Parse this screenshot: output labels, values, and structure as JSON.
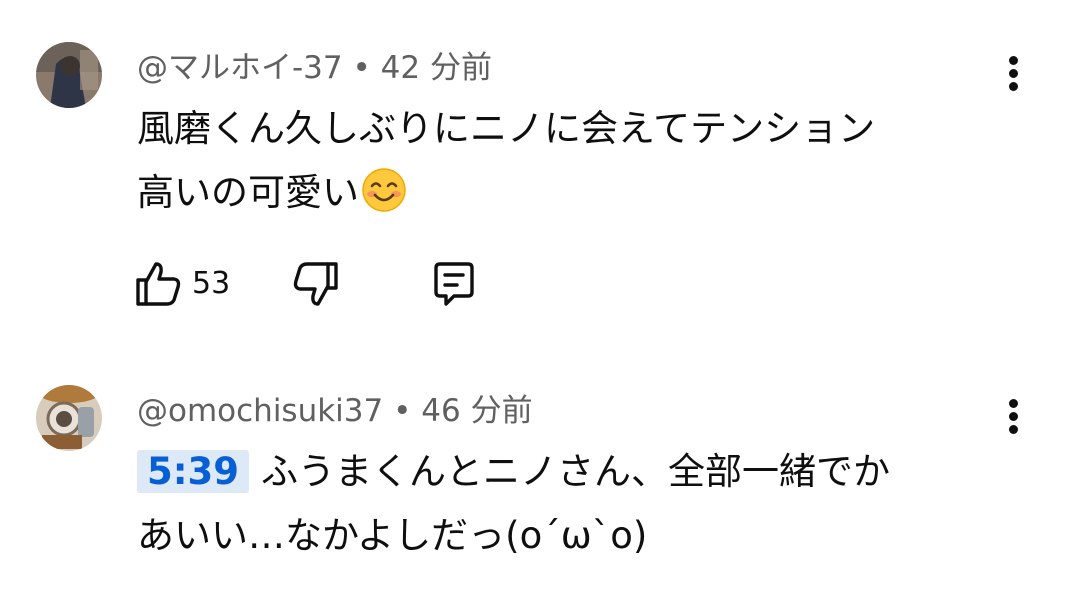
{
  "comments": [
    {
      "author": "@マルホイ-37",
      "separator": "•",
      "time": "42 分前",
      "text_line1": "風磨くん久しぶりにニノに会えてテンション",
      "text_line2": "高いの可愛い",
      "emoji": "smiling-face-emoji",
      "likes": "53",
      "avatar_colors": [
        "#3a3f4e",
        "#7c6f63"
      ]
    },
    {
      "author": "@omochisuki37",
      "separator": "•",
      "time": "46 分前",
      "timestamp_link": "5:39",
      "text_line1": "ふうまくんとニノさん、全部一緒でか",
      "text_line2": "あいい…なかよしだっ(o´ω`o)",
      "avatar_colors": [
        "#c9b9a3",
        "#6b5b4d"
      ]
    }
  ],
  "icons": {
    "like": "thumbs-up-icon",
    "dislike": "thumbs-down-icon",
    "reply": "reply-comment-icon",
    "menu": "more-vert-icon"
  },
  "colors": {
    "meta_text": "#606060",
    "timestamp_link": "#065fd4",
    "timestamp_bg": "#dde9f7"
  }
}
